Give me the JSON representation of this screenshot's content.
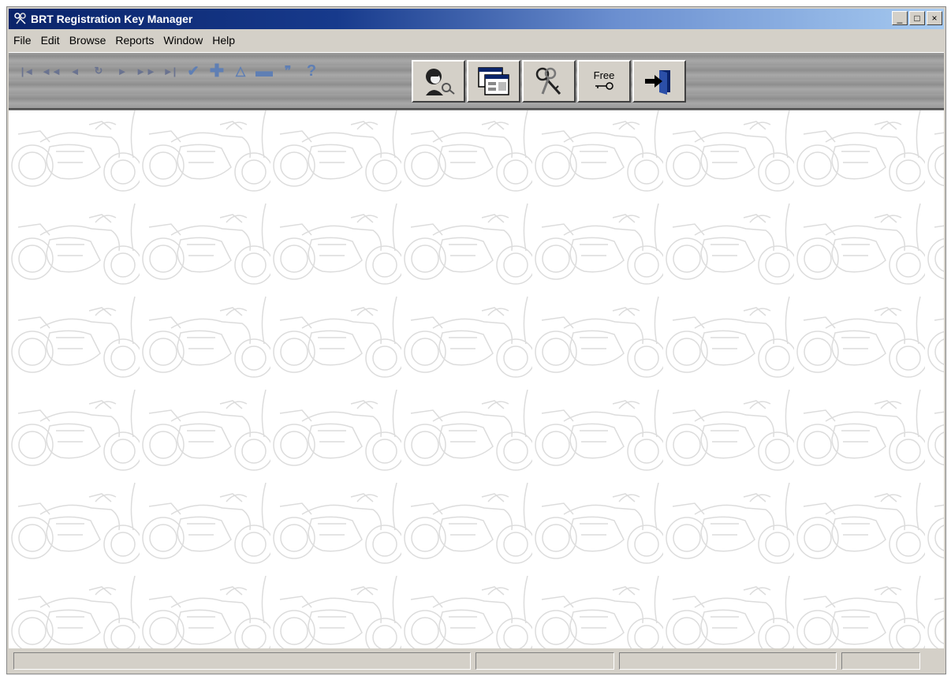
{
  "window": {
    "title": "BRT Registration Key Manager",
    "minimize": "_",
    "maximize": "□",
    "close": "×"
  },
  "menu": [
    "File",
    "Edit",
    "Browse",
    "Reports",
    "Window",
    "Help"
  ],
  "toolbar": {
    "nav": {
      "first": "|◄",
      "prev_page": "◄◄",
      "prev": "◄",
      "refresh": "↻",
      "next": "►",
      "next_page": "►►",
      "last": "►|",
      "save": "✔",
      "add": "✚",
      "edit": "△",
      "delete": "▬",
      "quote": "❞",
      "help": "?"
    },
    "buttons": {
      "free_label": "Free"
    }
  },
  "colors": {
    "title_start": "#0a246a",
    "title_end": "#a6caf0",
    "window_bg": "#d4d0c8",
    "watermark": "#dcdcdc"
  }
}
